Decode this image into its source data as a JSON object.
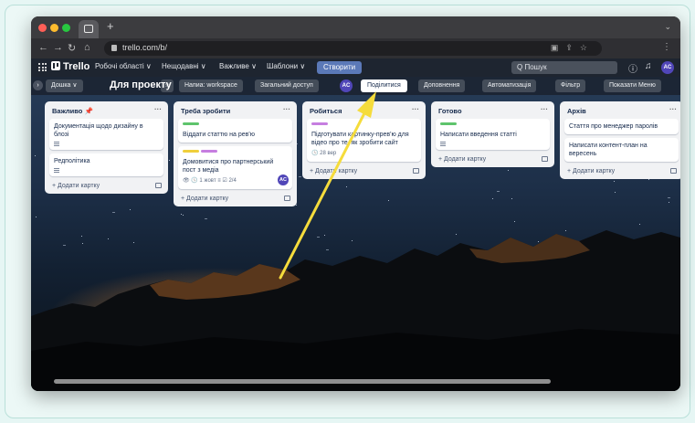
{
  "browser": {
    "url": "trello.com/b/",
    "new_tab": "+"
  },
  "trello": {
    "logo": "Trello",
    "nav": [
      "Робочі області ∨",
      "Нещодавні ∨",
      "Важливе ∨",
      "Шаблони ∨"
    ],
    "create_label": "Створити",
    "search_placeholder": "Q Пошук",
    "avatar": "AC"
  },
  "board": {
    "view_switcher": "Дошка ∨",
    "title": "Для проекту",
    "workspace": "Напиа: workspace",
    "visibility": "Загальний доступ",
    "member_avatar": "AC",
    "share_label": "Поділитися",
    "power_ups": "Доповнення",
    "automation": "Автоматизація",
    "filter": "Фільтр",
    "show_menu": "Показати Меню"
  },
  "lists": [
    {
      "title": "Важливо 📌",
      "cards": [
        {
          "title": "Документація щодо дизайну в блозі",
          "desc": true
        },
        {
          "title": "Редполітика",
          "desc": true
        }
      ],
      "add": "+ Додати картку"
    },
    {
      "title": "Треба зробити",
      "cards": [
        {
          "title": "Віддати статтю на рев'ю",
          "labels": [
            "#5ec46c"
          ]
        },
        {
          "title": "Домовитися про партнерський пост з медіа",
          "labels": [
            "#f0cf3b",
            "#c67ee0"
          ],
          "badges": "👁  🕓 1 жовт  ≡  ☑ 2/4",
          "avatar": "AC"
        }
      ],
      "add": "+ Додати картку"
    },
    {
      "title": "Робиться",
      "cards": [
        {
          "title": "Підготувати картинку-прев'ю для відео про те, як зробити сайт",
          "labels": [
            "#c67ee0"
          ],
          "badges": "🕓 28 вер"
        }
      ],
      "add": "+ Додати картку"
    },
    {
      "title": "Готово",
      "cards": [
        {
          "title": "Написати введення статті",
          "labels": [
            "#5ec46c"
          ],
          "desc": true
        }
      ],
      "add": "+ Додати картку"
    },
    {
      "title": "Архів",
      "cards": [
        {
          "title": "Стаття про менеджер паролів"
        },
        {
          "title": "Написати контент-план на вересень"
        }
      ],
      "add": "+ Додати картку"
    }
  ],
  "colors": {
    "header_bg": "#1e2530",
    "create_button": "#5b79b8",
    "arrow": "#f5dc3c",
    "avatar": "#5046b8"
  }
}
